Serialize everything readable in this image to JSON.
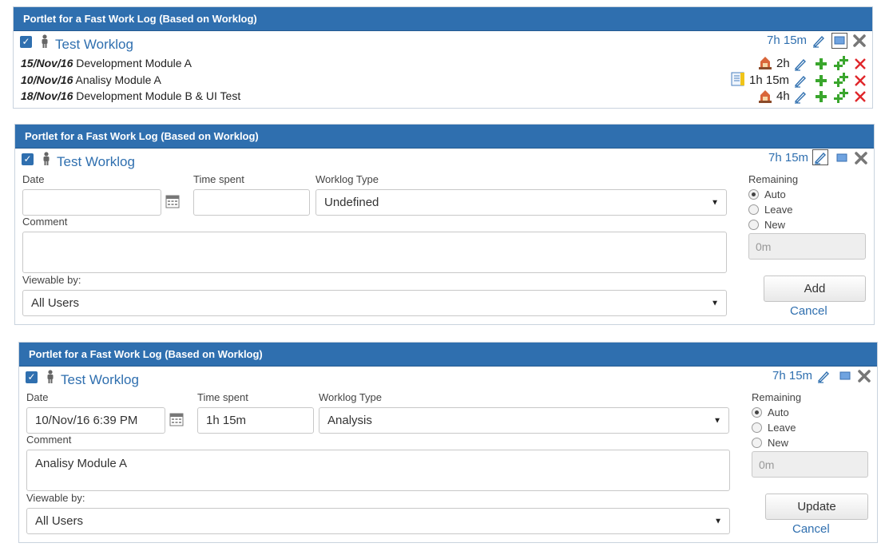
{
  "portlet_title": "Portlet for a Fast Work Log (Based on Worklog)",
  "worklog_name": "Test Worklog",
  "total_time": "7h 15m",
  "list_view": {
    "entries": [
      {
        "date": "15/Nov/16",
        "comment": "Development Module A",
        "time": "2h",
        "type_icon": "development-icon"
      },
      {
        "date": "10/Nov/16",
        "comment": "Analisy Module A",
        "time": "1h 15m",
        "type_icon": "analysis-icon"
      },
      {
        "date": "18/Nov/16",
        "comment": "Development Module B & UI Test",
        "time": "4h",
        "type_icon": "development-icon"
      }
    ]
  },
  "form_labels": {
    "date": "Date",
    "time_spent": "Time spent",
    "worklog_type": "Worklog Type",
    "comment": "Comment",
    "viewable_by": "Viewable by:",
    "remaining": "Remaining",
    "auto": "Auto",
    "leave": "Leave",
    "new": "New",
    "remaining_placeholder": "0m",
    "cancel": "Cancel"
  },
  "add_form": {
    "date_value": "",
    "time_value": "",
    "type_value": "Undefined",
    "comment_value": "",
    "viewable_value": "All Users",
    "remaining_selected": "Auto",
    "submit_label": "Add"
  },
  "edit_form": {
    "date_value": "10/Nov/16 6:39 PM",
    "time_value": "1h 15m",
    "type_value": "Analysis",
    "comment_value": "Analisy Module A",
    "viewable_value": "All Users",
    "remaining_selected": "Auto",
    "submit_label": "Update"
  },
  "colors": {
    "header": "#2f6faf",
    "link": "#2f6faf",
    "add_green": "#3aa62d",
    "delete_red": "#e0262b"
  }
}
